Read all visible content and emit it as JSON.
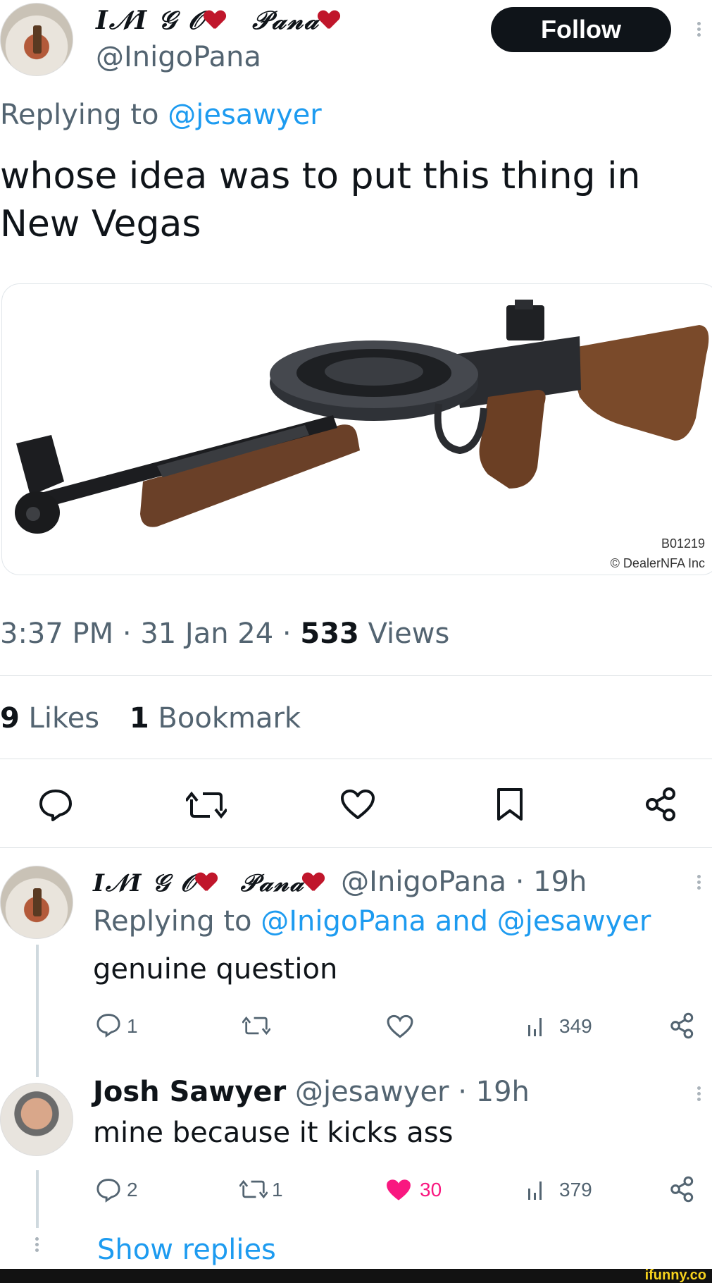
{
  "tweet": {
    "display_name": "I𝒩I 𝒢 𝒪",
    "display_name_suffix": "𝒫𝒶𝓃𝒶",
    "handle": "@InigoPana",
    "follow_label": "Follow",
    "replying_prefix": "Replying to",
    "replying_to": "@jesawyer",
    "text": "whose idea was to put this thing in New Vegas",
    "image_caption_line1": "B01219",
    "image_caption_line2": "© DealerNFA Inc",
    "time": "3:37 PM · 31 Jan 24 · ",
    "views_count": "533",
    "views_label": " Views",
    "likes_count": "9",
    "likes_label": " Likes",
    "bookmarks_count": "1",
    "bookmarks_label": " Bookmark"
  },
  "replies": [
    {
      "display_name": "I𝒩I 𝒢 𝒪",
      "display_name_suffix": "𝒫𝒶𝓃𝒶",
      "handle_time": "@InigoPana · 19h",
      "replying_prefix": "Replying to",
      "replying_to": "@InigoPana and @jesawyer",
      "text": "genuine question",
      "reply_count": "1",
      "retweet_count": "",
      "like_count": "",
      "views": "349"
    },
    {
      "display_name": "Josh Sawyer",
      "handle_time": "@jesawyer · 19h",
      "text": "mine because it kicks ass",
      "reply_count": "2",
      "retweet_count": "1",
      "like_count": "30",
      "views": "379"
    }
  ],
  "show_replies_label": "Show replies",
  "watermark": "ifunny.co",
  "colors": {
    "link": "#1d9bf0",
    "text": "#0f1419",
    "muted": "#536471",
    "like_active": "#f91880",
    "follow_bg": "#0f1419"
  }
}
